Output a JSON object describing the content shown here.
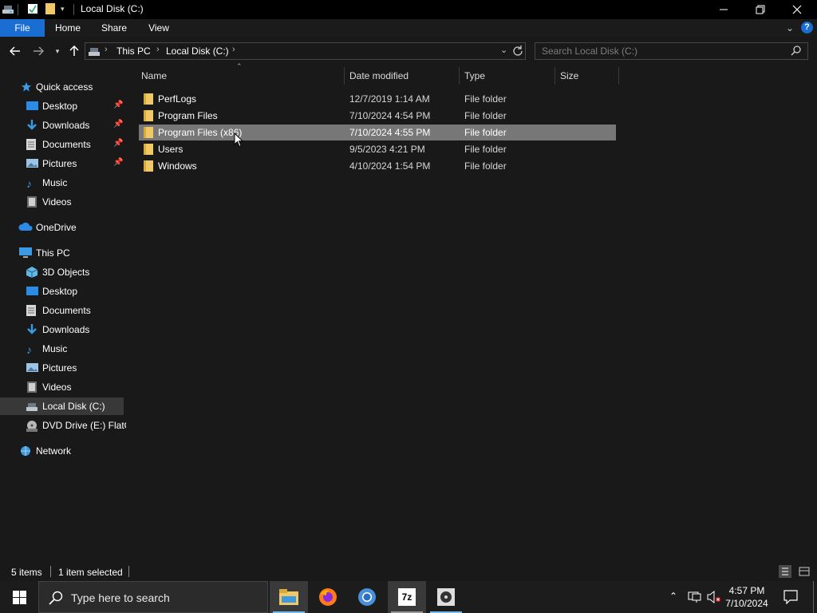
{
  "window": {
    "title": "Local Disk (C:)",
    "controls": {
      "minimize": "—",
      "maximize": "❐",
      "close": "✕"
    }
  },
  "ribbon": {
    "tabs": [
      "File",
      "Home",
      "Share",
      "View"
    ],
    "help": "?"
  },
  "address": {
    "crumbs": [
      "This PC",
      "Local Disk (C:)"
    ],
    "search_placeholder": "Search Local Disk (C:)"
  },
  "nav": {
    "quick_access": "Quick access",
    "quick_items": [
      "Desktop",
      "Downloads",
      "Documents",
      "Pictures",
      "Music",
      "Videos"
    ],
    "onedrive": "OneDrive",
    "this_pc": "This PC",
    "pc_items": [
      "3D Objects",
      "Desktop",
      "Documents",
      "Downloads",
      "Music",
      "Pictures",
      "Videos",
      "Local Disk (C:)",
      "DVD Drive (E:) FlatO"
    ],
    "network": "Network",
    "selected": "Local Disk (C:)"
  },
  "list": {
    "columns": [
      "Name",
      "Date modified",
      "Type",
      "Size"
    ],
    "rows": [
      {
        "name": "PerfLogs",
        "date": "12/7/2019 1:14 AM",
        "type": "File folder",
        "size": ""
      },
      {
        "name": "Program Files",
        "date": "7/10/2024 4:54 PM",
        "type": "File folder",
        "size": ""
      },
      {
        "name": "Program Files (x86)",
        "date": "7/10/2024 4:55 PM",
        "type": "File folder",
        "size": ""
      },
      {
        "name": "Users",
        "date": "9/5/2023 4:21 PM",
        "type": "File folder",
        "size": ""
      },
      {
        "name": "Windows",
        "date": "4/10/2024 1:54 PM",
        "type": "File folder",
        "size": ""
      }
    ],
    "selected_row": 2
  },
  "status": {
    "items_count": "5 items",
    "selection": "1 item selected"
  },
  "taskbar": {
    "search_text": "Type here to search",
    "time": "4:57 PM",
    "date": "7/10/2024",
    "seven_zip_label": "7z"
  },
  "colors": {
    "accent": "#1a6ed1",
    "folder": "#f0c868",
    "selection": "#777777"
  }
}
